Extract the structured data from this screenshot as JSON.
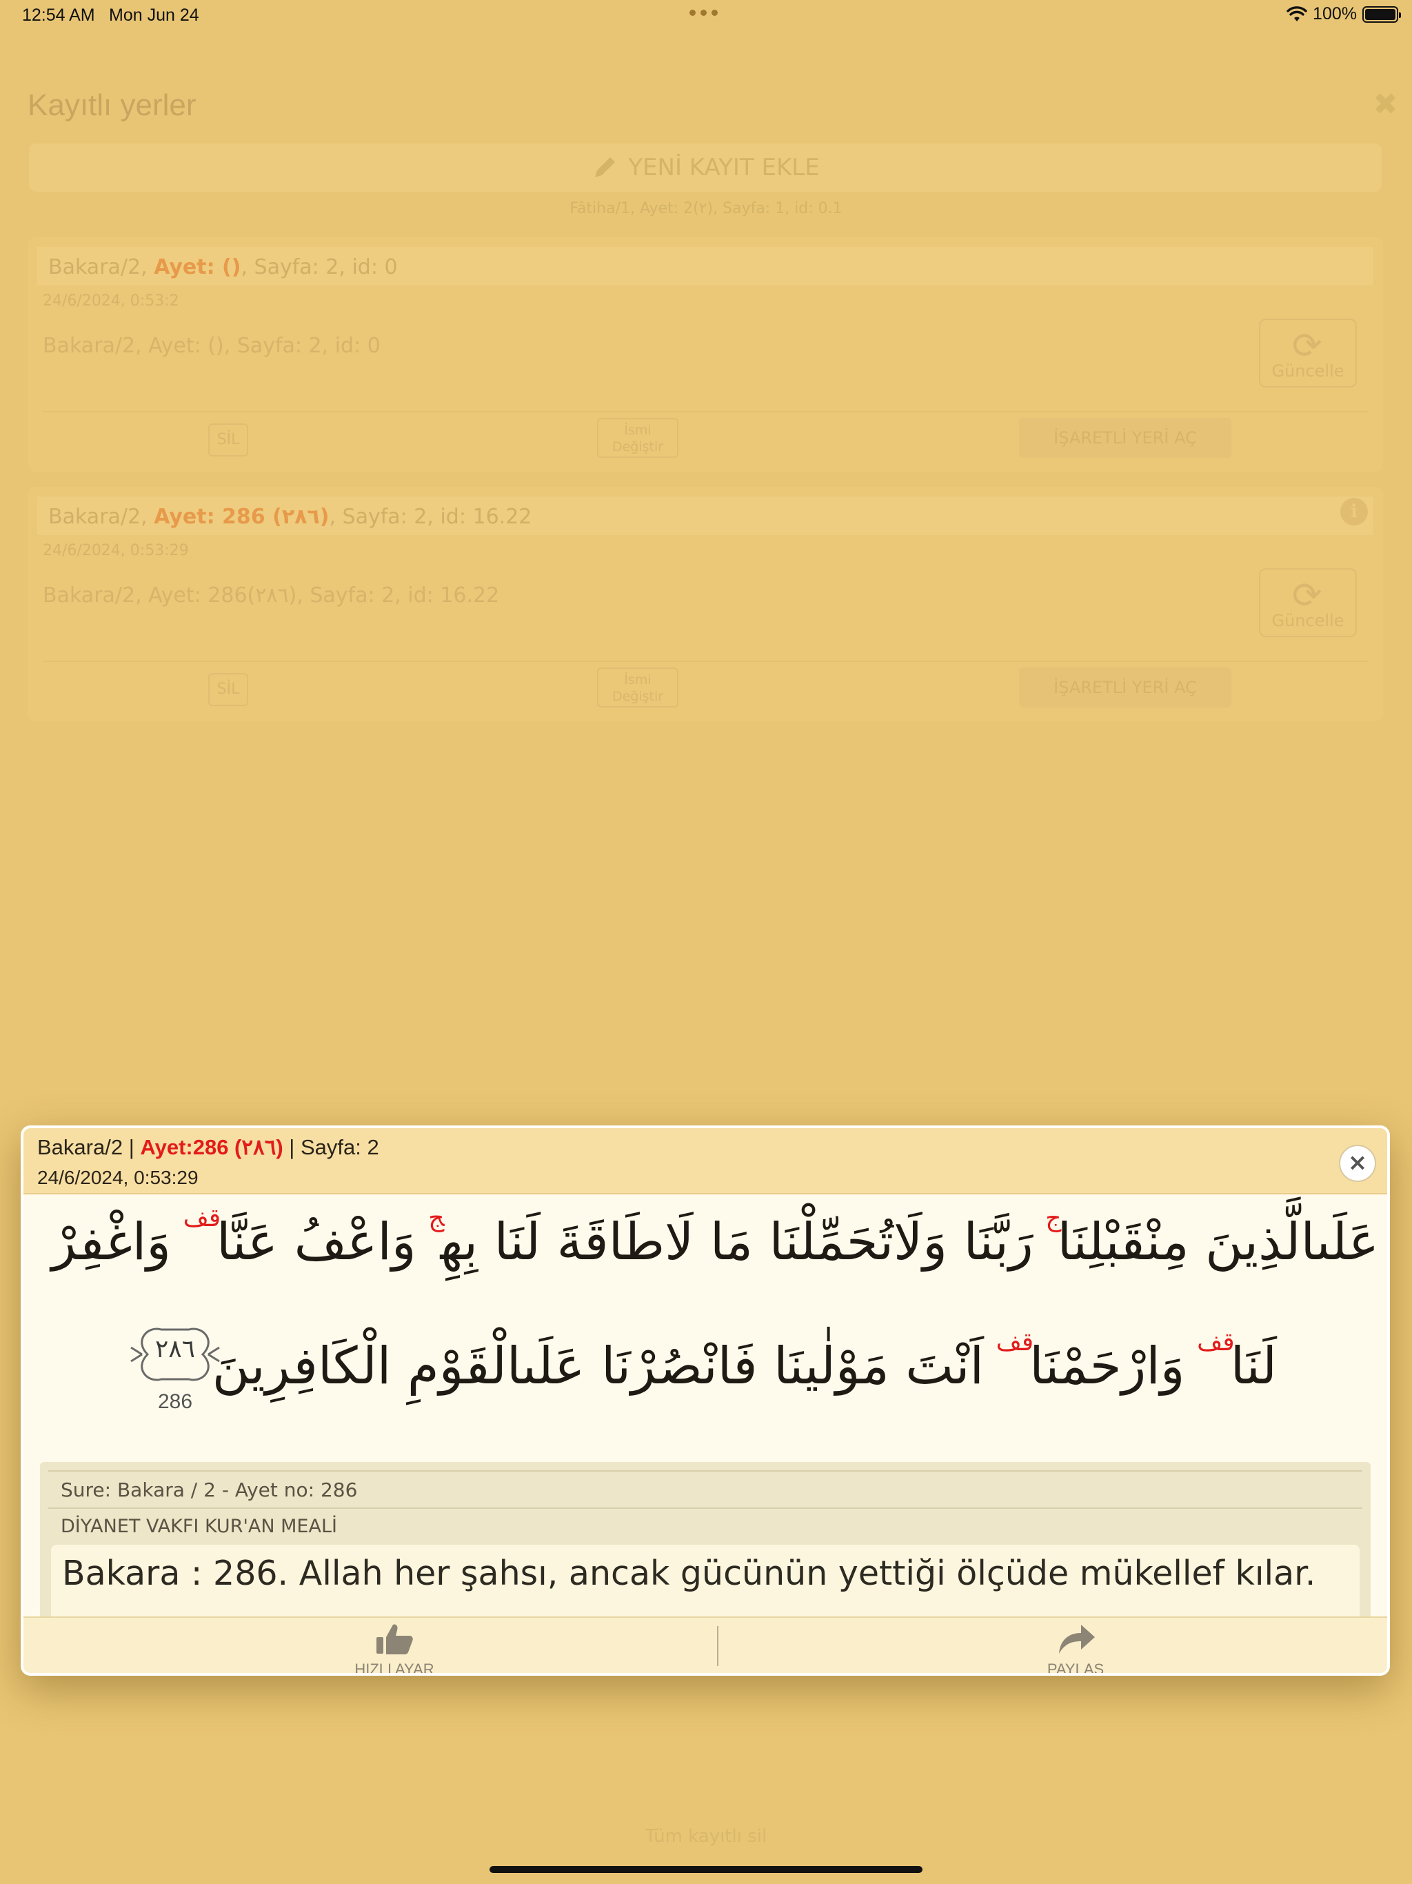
{
  "status_bar": {
    "time": "12:54 AM",
    "date": "Mon Jun 24",
    "battery": "100%",
    "battery_level": 1.0
  },
  "background": {
    "title": "Kayıtlı yerler",
    "new_record_label": "YENİ KAYIT EKLE",
    "current_position": "Fâtiha/1, Ayet: 2(٢), Sayfa: 1, id: 0.1",
    "records": [
      {
        "head_prefix": "Bakara/2, ",
        "head_ayet": "Ayet:  ()",
        "head_suffix": ", Sayfa: 2, id: 0",
        "date": "24/6/2024, 0:53:2",
        "body": "Bakara/2, Ayet: (), Sayfa: 2, id: 0",
        "refresh_label": "Güncelle",
        "delete_label": "SİL",
        "rename_label_1": "İsmi",
        "rename_label_2": "Değiştir",
        "open_label": "İŞARETLİ YERİ AÇ"
      },
      {
        "head_prefix": "Bakara/2, ",
        "head_ayet": "Ayet: 286 (٢٨٦)",
        "head_suffix": ", Sayfa: 2, id: 16.22",
        "date": "24/6/2024, 0:53:29",
        "body": "Bakara/2, Ayet: 286(٢٨٦), Sayfa: 2, id: 16.22",
        "refresh_label": "Güncelle",
        "delete_label": "SİL",
        "rename_label_1": "İsmi",
        "rename_label_2": "Değiştir",
        "open_label": "İŞARETLİ YERİ AÇ",
        "info_label": "i"
      }
    ],
    "delete_all_label": "Tüm kayıtlı sil"
  },
  "modal": {
    "title_prefix": "Bakara/2 | ",
    "title_ayet": "Ayet:286 (٢٨٦)",
    "title_suffix": " | Sayfa: 2",
    "date": "24/6/2024, 0:53:29",
    "close_label": "×",
    "arabic_line_1a": "عَلَىالَّذِينَ مِنْقَبْلِنَا",
    "arabic_mark_1": "ج",
    "arabic_line_1b": "رَبَّنَا وَلَاتُحَمِّلْنَا مَا لَاطَاقَةَ لَنَا بِهِ",
    "arabic_mark_2": "ج",
    "arabic_line_1c": "وَاعْفُ عَنَّا",
    "arabic_mark_3": "قف",
    "arabic_line_1d": "وَاغْفِرْ",
    "arabic_line_2a": "لَنَا",
    "arabic_mark_4": "قف",
    "arabic_line_2b": "وَارْحَمْنَا",
    "arabic_mark_5": "قف",
    "arabic_line_2c": "اَنْتَ مَوْلٰينَا فَانْصُرْنَا عَلَىالْقَوْمِ الْكَافِرِينَ",
    "ayah_number_arabic": "٢٨٦",
    "ayah_number": "286",
    "meal": {
      "sure_info": "Sure: Bakara / 2 - Ayet no: 286",
      "source": "DİYANET VAKFI KUR'AN MEALİ",
      "text": "Bakara : 286. Allah her şahsı, ancak gücünün yettiği ölçüde mükellef kılar."
    },
    "footer": {
      "quick_settings_label": "HIZLI AYAR",
      "share_label": "PAYLAŞ"
    }
  }
}
